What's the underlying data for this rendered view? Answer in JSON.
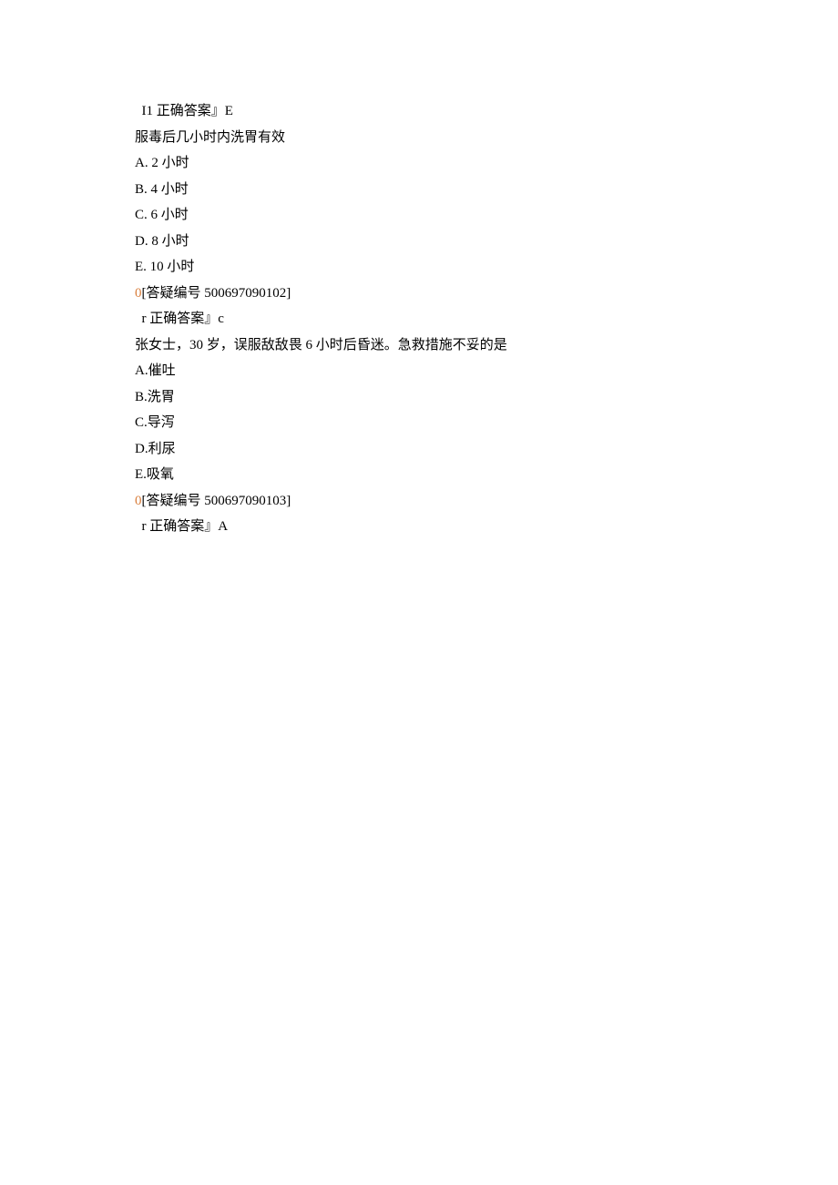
{
  "block1": {
    "answer_line": " I1 正确答案』E"
  },
  "question2": {
    "stem": "服毒后几小时内洗胃有效",
    "options": {
      "a": "A.  2 小时",
      "b": "B.  4 小时",
      "c": "C.  6 小时",
      "d": "D.  8 小时",
      "e": "E.  10 小时"
    },
    "ref_marker": "0",
    "ref_text": "[答疑编号 500697090102]",
    "answer_line": " r 正确答案』c"
  },
  "question3": {
    "stem": "张女士，30 岁，误服敌敌畏 6 小时后昏迷。急救措施不妥的是",
    "options": {
      "a": "A.催吐",
      "b": "B.洗胃",
      "c": "C.导泻",
      "d": "D.利尿",
      "e": "E.吸氧"
    },
    "ref_marker": "0",
    "ref_text": "[答疑编号 500697090103]",
    "answer_line_prefix": " r 正确答案』",
    "answer_letter": "A"
  }
}
